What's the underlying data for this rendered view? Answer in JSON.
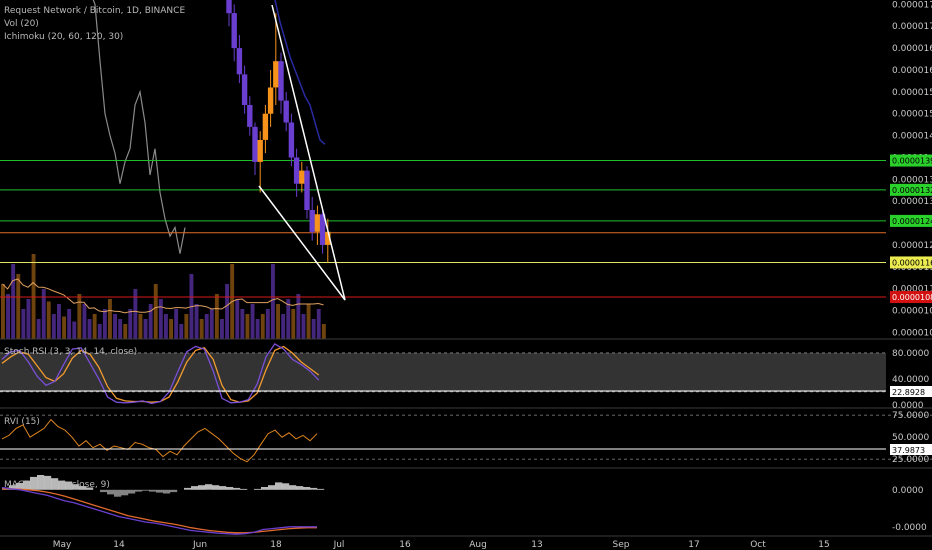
{
  "header": {
    "title": "Request Network / Bitcoin, 1D, BINANCE",
    "volume_label": "Vol (20)",
    "ichimoku_label": "Ichimoku (20, 60, 120, 30)"
  },
  "chart_data": {
    "type": "candlestick",
    "colors": {
      "up": "#f7931a",
      "down": "#6a3fd0",
      "background": "#000000",
      "wedge": "#ffffff",
      "green_lines": "#1fbf2a",
      "orange_line": "#e06a2a",
      "yellow_line": "#e5e565",
      "red_line": "#d61a1a"
    },
    "x_ticks": [
      "May",
      "14",
      "Jun",
      "18",
      "Jul",
      "16",
      "Aug",
      "13",
      "Sep",
      "17",
      "Oct",
      "15"
    ],
    "price_axis": {
      "ticks": [
        "0.00001750",
        "0.00001700",
        "0.00001650",
        "0.00001600",
        "0.00001550",
        "0.00001500",
        "0.00001450",
        "0.00001400",
        "0.00001350",
        "0.00001300",
        "0.00001250",
        "0.00001200",
        "0.00001150",
        "0.00001100",
        "0.00001050",
        "0.00001000"
      ],
      "range": [
        9.85e-06,
        1.76e-05
      ]
    },
    "price_levels": [
      {
        "label": "0.00001393",
        "value": 1.393e-05,
        "kind": "green"
      },
      {
        "label": "0.00001325",
        "value": 1.326e-05,
        "kind": "green"
      },
      {
        "label": "0.00001248",
        "value": 1.255e-05,
        "kind": "green"
      },
      {
        "label": "",
        "value": 1.228e-05,
        "kind": "orange"
      },
      {
        "label": "0.00001160",
        "value": 1.16e-05,
        "kind": "yellow"
      },
      {
        "label": "0.00001080",
        "value": 1.081e-05,
        "kind": "red"
      }
    ],
    "candles": [
      {
        "date": "Jun 7",
        "o": 1.78e-05,
        "h": 1.8e-05,
        "l": 1.7e-05,
        "c": 1.73e-05
      },
      {
        "date": "Jun 8",
        "o": 1.73e-05,
        "h": 1.75e-05,
        "l": 1.62e-05,
        "c": 1.65e-05
      },
      {
        "date": "Jun 9",
        "o": 1.65e-05,
        "h": 1.68e-05,
        "l": 1.57e-05,
        "c": 1.59e-05
      },
      {
        "date": "Jun 10",
        "o": 1.59e-05,
        "h": 1.61e-05,
        "l": 1.5e-05,
        "c": 1.52e-05
      },
      {
        "date": "Jun 11",
        "o": 1.52e-05,
        "h": 1.54e-05,
        "l": 1.45e-05,
        "c": 1.47e-05
      },
      {
        "date": "Jun 12",
        "o": 1.47e-05,
        "h": 1.48e-05,
        "l": 1.36e-05,
        "c": 1.39e-05
      },
      {
        "date": "Jun 13",
        "o": 1.39e-05,
        "h": 1.46e-05,
        "l": 1.32e-05,
        "c": 1.44e-05
      },
      {
        "date": "Jun 14",
        "o": 1.44e-05,
        "h": 1.52e-05,
        "l": 1.41e-05,
        "c": 1.5e-05
      },
      {
        "date": "Jun 15",
        "o": 1.5e-05,
        "h": 1.6e-05,
        "l": 1.47e-05,
        "c": 1.56e-05
      },
      {
        "date": "Jun 16",
        "o": 1.56e-05,
        "h": 1.73e-05,
        "l": 1.52e-05,
        "c": 1.62e-05
      },
      {
        "date": "Jun 17",
        "o": 1.62e-05,
        "h": 1.64e-05,
        "l": 1.5e-05,
        "c": 1.53e-05
      },
      {
        "date": "Jun 18",
        "o": 1.53e-05,
        "h": 1.55e-05,
        "l": 1.46e-05,
        "c": 1.48e-05
      },
      {
        "date": "Jun 19",
        "o": 1.48e-05,
        "h": 1.5e-05,
        "l": 1.38e-05,
        "c": 1.4e-05
      },
      {
        "date": "Jun 20",
        "o": 1.4e-05,
        "h": 1.42e-05,
        "l": 1.31e-05,
        "c": 1.34e-05
      },
      {
        "date": "Jun 21",
        "o": 1.34e-05,
        "h": 1.39e-05,
        "l": 1.32e-05,
        "c": 1.37e-05
      },
      {
        "date": "Jun 22",
        "o": 1.37e-05,
        "h": 1.38e-05,
        "l": 1.26e-05,
        "c": 1.28e-05
      },
      {
        "date": "Jun 23",
        "o": 1.28e-05,
        "h": 1.31e-05,
        "l": 1.21e-05,
        "c": 1.23e-05
      },
      {
        "date": "Jun 24",
        "o": 1.23e-05,
        "h": 1.29e-05,
        "l": 1.2e-05,
        "c": 1.27e-05
      },
      {
        "date": "Jun 25",
        "o": 1.27e-05,
        "h": 1.28e-05,
        "l": 1.18e-05,
        "c": 1.2e-05
      },
      {
        "date": "Jun 26",
        "o": 1.2e-05,
        "h": 1.26e-05,
        "l": 1.16e-05,
        "c": 1.23e-05
      }
    ],
    "volume_values": [
      22,
      18,
      30,
      26,
      12,
      16,
      34,
      8,
      20,
      15,
      10,
      14,
      9,
      12,
      7,
      18,
      14,
      8,
      10,
      6,
      12,
      16,
      10,
      8,
      6,
      12,
      20,
      10,
      8,
      14,
      22,
      16,
      10,
      8,
      12,
      6,
      10,
      26,
      14,
      8,
      10,
      12,
      18,
      8,
      22,
      30,
      16,
      12,
      10,
      14,
      8,
      10,
      12,
      30,
      14,
      10,
      16,
      12,
      18,
      10,
      14,
      8,
      12,
      6
    ],
    "stoch_rsi": {
      "label": "Stoch RSI (3, 3, 14, 14, close)",
      "ticks": [
        "80.0000",
        "40.0000",
        "0.0000"
      ],
      "current": "22.8928",
      "range": [
        -5,
        100
      ],
      "k": [
        70,
        82,
        84,
        66,
        44,
        30,
        36,
        62,
        86,
        88,
        64,
        40,
        12,
        4,
        3,
        4,
        6,
        2,
        5,
        20,
        52,
        82,
        90,
        86,
        52,
        10,
        3,
        4,
        8,
        32,
        74,
        94,
        86,
        70,
        62,
        52,
        38
      ],
      "d": [
        64,
        74,
        82,
        78,
        60,
        42,
        36,
        48,
        72,
        84,
        78,
        58,
        28,
        10,
        6,
        5,
        5,
        4,
        5,
        12,
        36,
        66,
        84,
        88,
        70,
        30,
        8,
        4,
        6,
        18,
        54,
        84,
        90,
        80,
        66,
        56,
        46
      ]
    },
    "rvi": {
      "label": "RVI (15)",
      "ticks": [
        "75.0000",
        "50.0000",
        "25.0000"
      ],
      "current": "37.9873",
      "range": [
        15,
        82
      ],
      "values": [
        48,
        52,
        60,
        64,
        50,
        55,
        60,
        70,
        62,
        58,
        50,
        40,
        46,
        38,
        42,
        35,
        40,
        38,
        36,
        44,
        42,
        38,
        36,
        28,
        34,
        30,
        40,
        48,
        56,
        60,
        54,
        48,
        40,
        32,
        26,
        22,
        30,
        42,
        54,
        58,
        50,
        55,
        48,
        52,
        46,
        54
      ]
    },
    "macd": {
      "label": "MACD (12, 26, close, 9)",
      "ticks": [
        "0.0000",
        "-0.0000"
      ],
      "range": [
        -1.0,
        0.45
      ],
      "histogram": [
        0.05,
        0.1,
        0.15,
        0.2,
        0.28,
        0.32,
        0.3,
        0.25,
        0.2,
        0.18,
        0.12,
        0.08,
        0.05,
        0.0,
        -0.05,
        -0.1,
        -0.15,
        -0.12,
        -0.08,
        -0.04,
        -0.02,
        -0.04,
        -0.06,
        -0.08,
        -0.05,
        0.0,
        0.04,
        0.08,
        0.1,
        0.12,
        0.1,
        0.08,
        0.06,
        0.04,
        0.02,
        0.0,
        0.02,
        0.06,
        0.1,
        0.16,
        0.14,
        0.1,
        0.08,
        0.06,
        0.04,
        0.02
      ],
      "macd_line": [
        0.05,
        0.02,
        0.0,
        -0.04,
        -0.08,
        -0.12,
        -0.18,
        -0.24,
        -0.28,
        -0.34,
        -0.4,
        -0.46,
        -0.52,
        -0.58,
        -0.62,
        -0.66,
        -0.7,
        -0.72,
        -0.76,
        -0.8,
        -0.84,
        -0.88,
        -0.9,
        -0.92,
        -0.94,
        -0.95,
        -0.96,
        -0.95,
        -0.92,
        -0.86,
        -0.84,
        -0.82,
        -0.8,
        -0.8,
        -0.8,
        -0.8
      ],
      "signal_line": [
        0.02,
        0.02,
        0.01,
        0.0,
        -0.02,
        -0.05,
        -0.09,
        -0.14,
        -0.2,
        -0.26,
        -0.32,
        -0.38,
        -0.44,
        -0.5,
        -0.56,
        -0.6,
        -0.64,
        -0.68,
        -0.71,
        -0.74,
        -0.78,
        -0.82,
        -0.85,
        -0.88,
        -0.9,
        -0.92,
        -0.93,
        -0.93,
        -0.92,
        -0.9,
        -0.88,
        -0.86,
        -0.84,
        -0.83,
        -0.82,
        -0.82
      ]
    }
  }
}
